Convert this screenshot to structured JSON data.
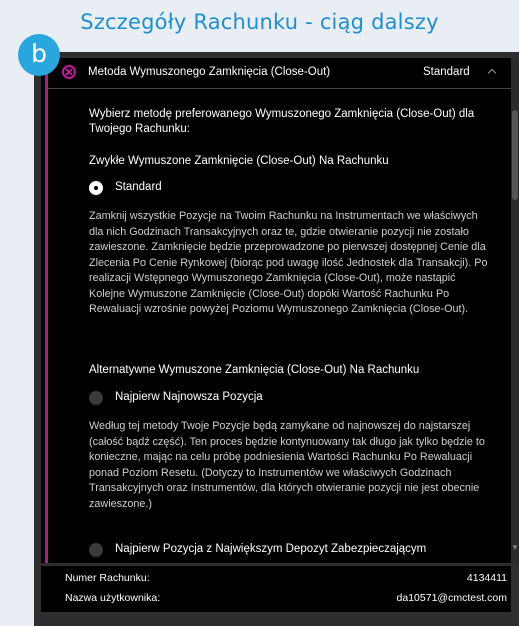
{
  "page": {
    "title": "Szczegóły Rachunku - ciąg dalszy",
    "step_badge": "b"
  },
  "section": {
    "header_label": "Metoda Wymuszonego Zamknięcia (Close-Out)",
    "header_value": "Standard",
    "intro": "Wybierz metodę preferowanego Wymuszonego Zamknięcia (Close-Out) dla Twojego Rachunku:",
    "standard_group": {
      "heading": "Zwykłe Wymuszone Zamknięcie (Close-Out) Na Rachunku",
      "option_label": "Standard",
      "option_selected": true,
      "description": "Zamknij wszystkie Pozycje na Twoim Rachunku na Instrumentach we właściwych dla nich Godzinach Transakcyjnych oraz te, gdzie otwieranie pozycji nie zostało zawieszone. Zamknięcie będzie przeprowadzone po pierwszej dostępnej Cenie dla Zlecenia Po Cenie Rynkowej (biorąc pod uwagę ilość Jednostek dla Transakcji). Po realizacji Wstępnego Wymuszonego Zamknięcia (Close-Out), może nastąpić Kolejne Wymuszone Zamknięcie (Close-Out) dopóki Wartość Rachunku Po Rewaluacji wzrośnie powyżej Poziomu Wymuszonego Zamknięcia (Close-Out)."
    },
    "alternative_group": {
      "heading": "Alternatywne Wymuszone Zamknięcia (Close-Out) Na Rachunku",
      "option1_label": "Najpierw Najnowsza Pozycja",
      "option1_description": "Według tej metody Twoje Pozycje będą zamykane od najnowszej do najstarszej (całość bądź część). Ten proces będzie kontynuowany tak długo jak tylko będzie to konieczne, mając na celu próbę podniesienia Wartości Rachunku Po Rewaluacji ponad Poziom Resetu. (Dotyczy to Instrumentów we właściwych Godzinach Transakcyjnych oraz Instrumentów, dla których otwieranie pozycji nie jest obecnie zawieszone.)",
      "option2_label": "Najpierw Pozycja z Największym Depozyt Zabezpieczającym"
    }
  },
  "footer": {
    "account_number_label": "Numer Rachunku:",
    "account_number_value": "4134411",
    "username_label": "Nazwa użytkownika:",
    "username_value": "da10571@cmctest.com"
  },
  "colors": {
    "accent": "#b0198f",
    "title_blue": "#1f8fcf",
    "badge_blue": "#2aa6df"
  }
}
